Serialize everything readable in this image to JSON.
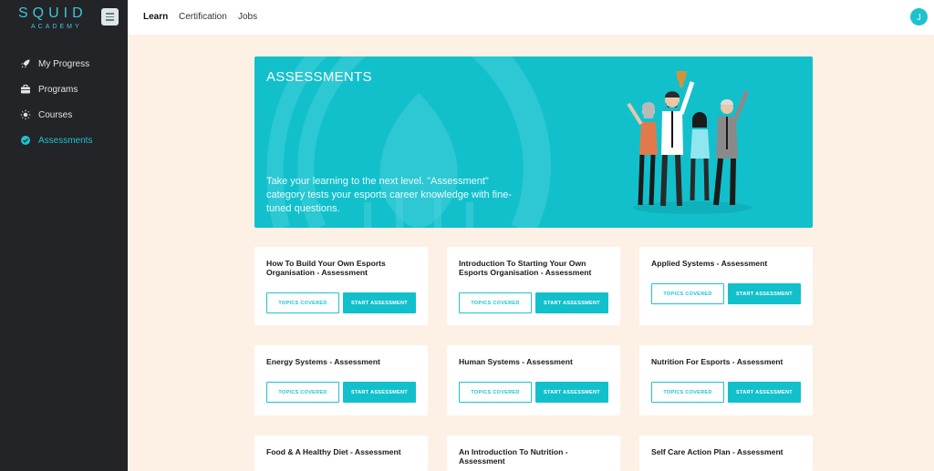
{
  "brand": {
    "name": "SQUID",
    "sub": "ACADEMY"
  },
  "sidebar": {
    "items": [
      {
        "label": "My Progress",
        "icon": "rocket-icon",
        "active": false
      },
      {
        "label": "Programs",
        "icon": "briefcase-icon",
        "active": false
      },
      {
        "label": "Courses",
        "icon": "lightbulb-icon",
        "active": false
      },
      {
        "label": "Assessments",
        "icon": "check-circle-icon",
        "active": true
      }
    ]
  },
  "topbar": {
    "tabs": [
      {
        "label": "Learn",
        "active": true
      },
      {
        "label": "Certification",
        "active": false
      },
      {
        "label": "Jobs",
        "active": false
      }
    ],
    "avatar_initial": "J"
  },
  "banner": {
    "title": "ASSESSMENTS",
    "text": "Take your learning to the next level. \"Assessment\" category tests your esports career knowledge with fine-tuned questions."
  },
  "buttons": {
    "topics": "TOPICS COVERED",
    "start": "START ASSESSMENT"
  },
  "cards": [
    {
      "title": "How To Build Your Own Esports Organisation - Assessment"
    },
    {
      "title": "Introduction To Starting Your Own Esports Organisation - Assessment"
    },
    {
      "title": "Applied Systems - Assessment"
    },
    {
      "title": "Energy Systems - Assessment"
    },
    {
      "title": "Human Systems - Assessment"
    },
    {
      "title": "Nutrition For Esports - Assessment"
    },
    {
      "title": "Food & A Healthy Diet - Assessment"
    },
    {
      "title": "An Introduction To Nutrition - Assessment"
    },
    {
      "title": "Self Care Action Plan - Assessment"
    }
  ],
  "colors": {
    "accent": "#12c0cc",
    "sidebar": "#222427",
    "page_bg": "#fdf1e6"
  }
}
